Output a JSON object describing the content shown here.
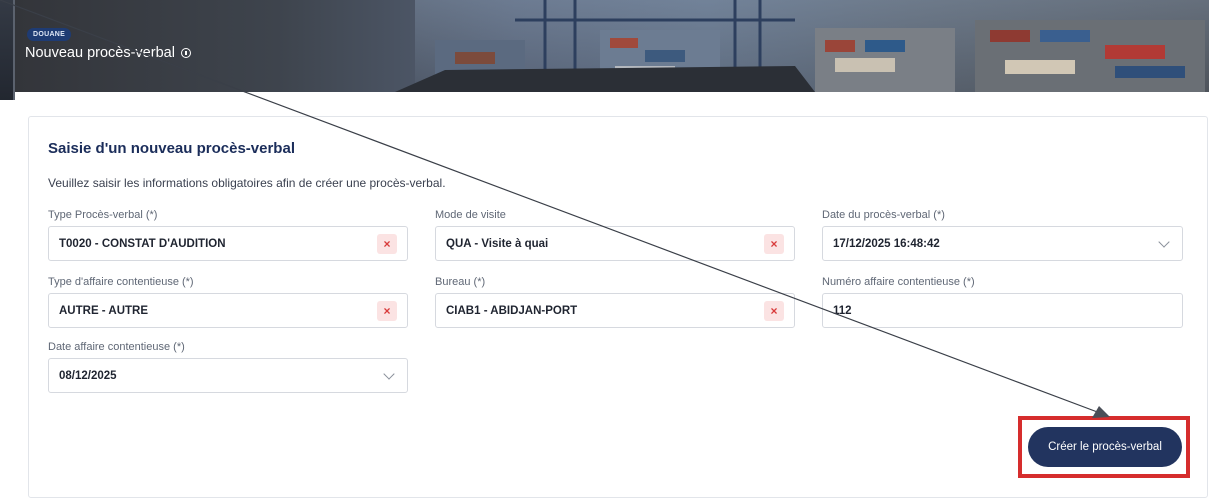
{
  "header": {
    "badge": "DOUANE",
    "title": "Nouveau procès-verbal"
  },
  "form": {
    "title": "Saisie d'un nouveau procès-verbal",
    "description": "Veuillez saisir les informations obligatoires afin de créer une procès-verbal.",
    "fields": {
      "type_pv": {
        "label": "Type Procès-verbal (*)",
        "value": "T0020 - CONSTAT D'AUDITION"
      },
      "mode_visite": {
        "label": "Mode de visite",
        "value": "QUA - Visite à quai"
      },
      "date_pv": {
        "label": "Date du procès-verbal (*)",
        "value": "17/12/2025 16:48:42"
      },
      "type_affaire": {
        "label": "Type d'affaire contentieuse (*)",
        "value": "AUTRE - AUTRE"
      },
      "bureau": {
        "label": "Bureau (*)",
        "value": "CIAB1 - ABIDJAN-PORT"
      },
      "numero_affaire": {
        "label": "Numéro affaire contentieuse (*)",
        "value": "112"
      },
      "date_affaire": {
        "label": "Date affaire contentieuse (*)",
        "value": "08/12/2025"
      }
    },
    "clear_symbol": "×",
    "submit_label": "Créer le procès-verbal"
  },
  "colors": {
    "primary": "#22345f",
    "badge": "#1e3b73",
    "highlight": "#d62d2d",
    "clear": "#d83a3a"
  },
  "icons": [
    "info-icon",
    "clear-icon",
    "chevron-down-icon"
  ]
}
